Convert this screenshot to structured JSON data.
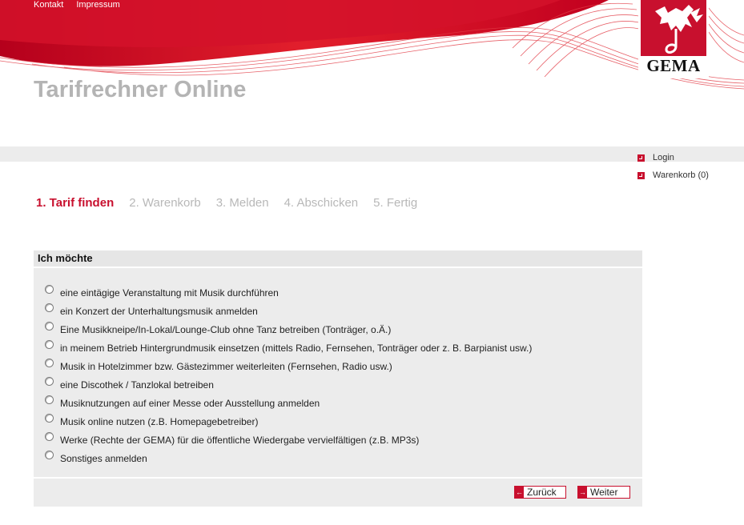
{
  "topnav": {
    "kontakt": "Kontakt",
    "impressum": "Impressum"
  },
  "logo": {
    "text": "GEMA"
  },
  "page_title": "Tarifrechner Online",
  "usernav": {
    "login": "Login",
    "cart": "Warenkorb (0)"
  },
  "steps": [
    {
      "label": "1. Tarif finden",
      "active": true
    },
    {
      "label": "2. Warenkorb",
      "active": false
    },
    {
      "label": "3. Melden",
      "active": false
    },
    {
      "label": "4. Abschicken",
      "active": false
    },
    {
      "label": "5. Fertig",
      "active": false
    }
  ],
  "panel": {
    "heading": "Ich möchte",
    "options": [
      "eine eintägige Veranstaltung mit Musik durchführen",
      "ein Konzert der Unterhaltungsmusik anmelden",
      "Eine Musikkneipe/In-Lokal/Lounge-Club ohne Tanz betreiben (Tonträger, o.Ä.)",
      "in meinem Betrieb Hintergrundmusik einsetzen (mittels Radio, Fernsehen, Tonträger oder z. B. Barpianist usw.)",
      "Musik in Hotelzimmer bzw. Gästezimmer weiterleiten (Fernsehen, Radio usw.)",
      "eine Discothek / Tanzlokal betreiben",
      "Musiknutzungen auf einer Messe oder Ausstellung anmelden",
      "Musik online nutzen (z.B. Homepagebetreiber)",
      "Werke (Rechte der GEMA) für die öffentliche Wiedergabe vervielfältigen (z.B. MP3s)",
      "Sonstiges anmelden"
    ],
    "back": "Zurück",
    "next": "Weiter"
  },
  "colors": {
    "brand_red": "#c8102e",
    "panel_grey": "#ececec",
    "title_grey": "#b4b4b4"
  }
}
